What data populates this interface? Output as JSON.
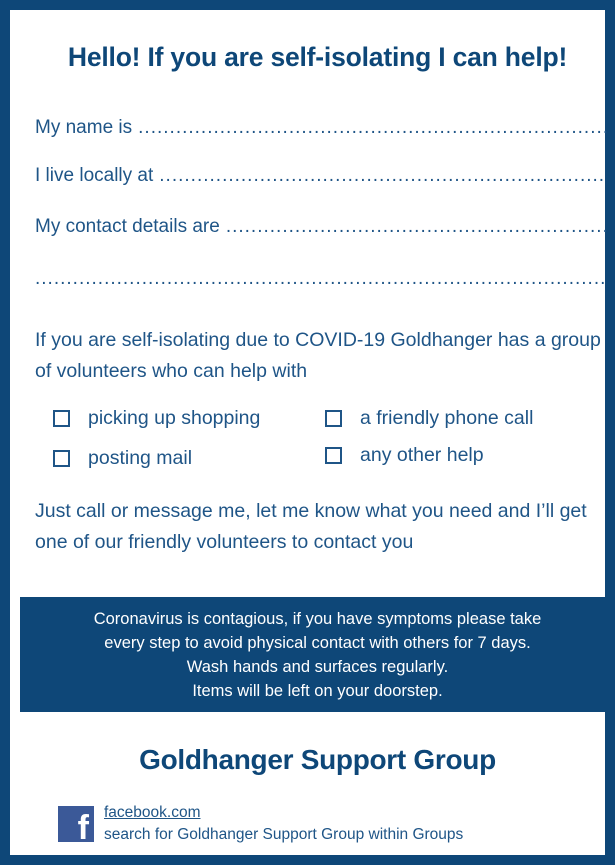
{
  "heading": "Hello! If you are self-isolating I can help!",
  "form": {
    "name_label": "My name is",
    "address_label": "I live locally at",
    "contact_label": "My contact details are"
  },
  "intro": "If you are self-isolating due to COVID-19 Goldhanger has a group of volunteers who can help with",
  "options": [
    "picking up shopping",
    "a friendly phone call",
    "posting mail",
    "any other help"
  ],
  "callout": "Just call or message me, let me know what you need and I’ll get one of our friendly volunteers to contact you",
  "notice": {
    "line1": "Coronavirus is contagious, if you have symptoms please take",
    "line2": "every step to avoid physical contact with others for 7 days.",
    "line3": "Wash hands and surfaces regularly.",
    "line4": "Items will be left on your doorstep."
  },
  "group_name": "Goldhanger Support Group",
  "facebook": {
    "link": "facebook.com",
    "instruction": "search for Goldhanger Support Group within Groups"
  },
  "colors": {
    "brand_blue": "#0e4778",
    "text_blue": "#1f5587",
    "facebook_blue": "#3b5998"
  }
}
